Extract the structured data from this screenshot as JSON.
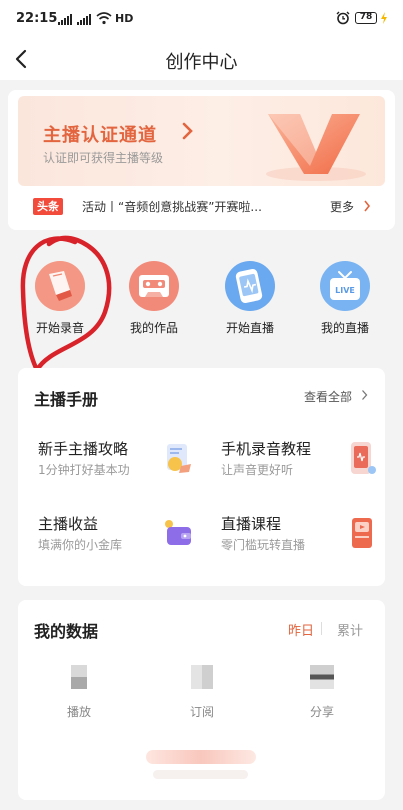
{
  "status_bar": {
    "time": "22:15",
    "network": "HD",
    "battery": "78"
  },
  "nav": {
    "title": "创作中心"
  },
  "banner": {
    "title": "主播认证通道",
    "subtitle": "认证即可获得主播等级"
  },
  "news": {
    "badge": "头条",
    "text": "活动丨“音频创意挑战赛”开赛啦...",
    "more_label": "更多"
  },
  "shortcuts": [
    {
      "label": "开始录音",
      "icon": "mic-record-icon"
    },
    {
      "label": "我的作品",
      "icon": "cassette-icon"
    },
    {
      "label": "开始直播",
      "icon": "live-phone-icon"
    },
    {
      "label": "我的直播",
      "icon": "live-tv-icon"
    }
  ],
  "handbook": {
    "title": "主播手册",
    "more_label": "查看全部",
    "items": [
      {
        "title": "新手主播攻略",
        "subtitle": "1分钟打好基本功",
        "icon": "guide-notebook-icon"
      },
      {
        "title": "手机录音教程",
        "subtitle": "让声音更好听",
        "icon": "phone-record-icon"
      },
      {
        "title": "主播收益",
        "subtitle": "填满你的小金库",
        "icon": "wallet-icon"
      },
      {
        "title": "直播课程",
        "subtitle": "零门槛玩转直播",
        "icon": "course-book-icon"
      }
    ]
  },
  "data_panel": {
    "title": "我的数据",
    "tabs": [
      {
        "label": "昨日",
        "active": true
      },
      {
        "label": "累计",
        "active": false
      }
    ],
    "stats": [
      {
        "label": "播放"
      },
      {
        "label": "订阅"
      },
      {
        "label": "分享"
      }
    ]
  },
  "colors": {
    "accent": "#e2653f",
    "badge": "#f24b3c",
    "annotation": "#d8232a"
  }
}
